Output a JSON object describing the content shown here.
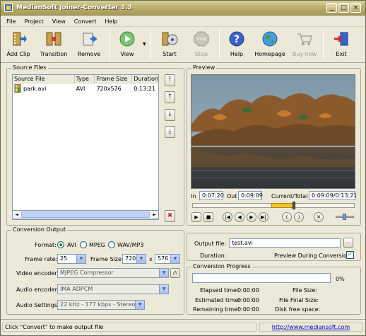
{
  "window": {
    "title": "MedianSoft Joiner-Converter 3.3"
  },
  "menu": [
    "File",
    "Project",
    "View",
    "Convert",
    "Help"
  ],
  "toolbar": {
    "add_clip": "Add Clip",
    "transition": "Transition",
    "remove": "Remove",
    "view": "View",
    "start": "Start",
    "stop": "Stop",
    "help": "Help",
    "homepage": "Homepage",
    "buy_now": "Buy now",
    "exit": "Exit"
  },
  "source_files": {
    "title": "Source Files",
    "columns": [
      "Source File",
      "Type",
      "Frame Size",
      "Duration"
    ],
    "rows": [
      {
        "file": "park.avi",
        "type": "AVI",
        "frame_size": "720x576",
        "duration": "0:13:21"
      }
    ]
  },
  "preview": {
    "title": "Preview",
    "in_label": "In",
    "in_value": "0:07:20",
    "out_label": "Out",
    "out_value": "0:09:09",
    "current_total_label": "Current/Total",
    "current_total_value": "0:09:09/0:13:21",
    "position_fraction": 0.62
  },
  "conversion_output": {
    "title": "Conversion Output",
    "format_label": "Format:",
    "formats": [
      "AVI",
      "MPEG",
      "WAV/MP3"
    ],
    "selected_format": "AVI",
    "frame_rate_label": "Frame rate:",
    "frame_rate": "25",
    "frame_size_label": "Frame Size:",
    "frame_width": "720",
    "x_label": "x",
    "frame_height": "576",
    "video_encoder_label": "Video encoder:",
    "video_encoder": "MJPEG Compressor",
    "audio_encoder_label": "Audio encoder:",
    "audio_encoder": "IMA ADPCM",
    "audio_settings_label": "Audio Settings:",
    "audio_settings": "22 kHz -  177 kbps - Stereo"
  },
  "output": {
    "file_label": "Output file:",
    "file_value": "test.avi",
    "browse_label": "...",
    "duration_label": "Duration:",
    "preview_label": "Preview During Conversion",
    "preview_checked": true
  },
  "progress": {
    "title": "Conversion Progress",
    "percent": "0%",
    "elapsed_label": "Elapsed time:",
    "elapsed_value": "0:00:00",
    "estimated_label": "Estimated time:",
    "estimated_value": "0:00:00",
    "remaining_label": "Remaining time:",
    "remaining_value": "0:00:00",
    "file_size_label": "File Size:",
    "final_size_label": "File Final Size:",
    "disk_free_label": "Disk free space:"
  },
  "status": {
    "message": "Click \"Convert\" to make output file",
    "url": "http://www.mediansoft.com"
  },
  "colors": {
    "accent": "#21a121",
    "titlebar": "#b9ad6a",
    "link": "#0000cc"
  }
}
